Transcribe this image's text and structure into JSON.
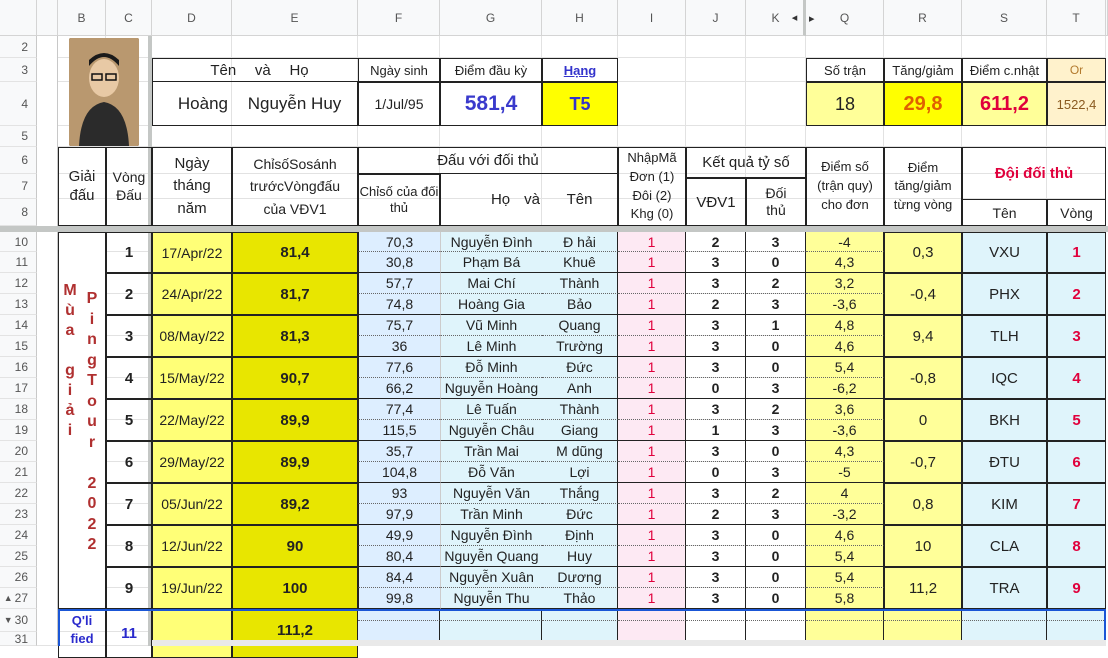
{
  "columns": [
    "B",
    "C",
    "D",
    "E",
    "F",
    "G",
    "H",
    "I",
    "J",
    "K",
    "Q",
    "R",
    "S",
    "T"
  ],
  "rows": [
    "2",
    "3",
    "4",
    "5",
    "6",
    "7",
    "8",
    "10",
    "11",
    "12",
    "13",
    "14",
    "15",
    "16",
    "17",
    "18",
    "19",
    "20",
    "21",
    "22",
    "23",
    "24",
    "25",
    "26",
    "27",
    "30",
    "31"
  ],
  "header": {
    "name_label1": "Tên",
    "name_label2": "và",
    "name_label3": "Họ",
    "birth_label": "Ngày sinh",
    "start_points_label": "Điểm đầu kỳ",
    "rank_label": "Hạng",
    "first_name": "Hoàng",
    "last_name": "Nguyễn Huy",
    "birth_date": "1/Jul/95",
    "start_points": "581,4",
    "rank": "T5",
    "matches_label": "Số trận",
    "change_label": "Tăng/giảm",
    "updated_label": "Điểm c.nhật",
    "or_label": "Or",
    "matches": "18",
    "change": "29,8",
    "updated": "611,2",
    "or_value": "1522,4"
  },
  "table_header": {
    "tournament": "Giải đấu",
    "round": "Vòng Đấu",
    "date": "Ngày tháng năm",
    "index_before": "ChỉsốSosánh trướcVòngđấu của VĐV1",
    "vs_opponent": "Đấu với đối thủ",
    "opp_index": "Chỉsố của đối thủ",
    "opp_name_a": "Họ",
    "opp_name_b": "và",
    "opp_name_c": "Tên",
    "input_code": "NhậpMã Đơn (1) Đôi (2) Khg (0)",
    "result": "Kết quả tỷ số",
    "vdv1": "VĐV1",
    "opponent": "Đối thủ",
    "score": "Điểm số (trận quy) cho đơn",
    "points_change": "Điểm tăng/giảm từng vòng",
    "opp_team": "Đội đối thủ",
    "team_name": "Tên",
    "team_round": "Vòng"
  },
  "tournament_title_col1": [
    "M",
    "ù",
    "a",
    "",
    "g",
    "i",
    "ả",
    "i"
  ],
  "tournament_title_col2": [
    "P",
    "i",
    "n",
    "g",
    "T",
    "o",
    "u",
    "r",
    "",
    "2",
    "0",
    "2",
    "2"
  ],
  "rounds": [
    {
      "round": "1",
      "date": "17/Apr/22",
      "index": "81,4",
      "change": "0,3",
      "team": "VXU",
      "team_round": "1",
      "matches": [
        {
          "opp_index": "70,3",
          "mid": "Nguyễn Đình",
          "last": "Đ hải",
          "code": "1",
          "v1": "2",
          "v2": "3",
          "score": "-4"
        },
        {
          "opp_index": "30,8",
          "mid": "Phạm Bá",
          "last": "Khuê",
          "code": "1",
          "v1": "3",
          "v2": "0",
          "score": "4,3"
        }
      ]
    },
    {
      "round": "2",
      "date": "24/Apr/22",
      "index": "81,7",
      "change": "-0,4",
      "team": "PHX",
      "team_round": "2",
      "matches": [
        {
          "opp_index": "57,7",
          "mid": "Mai Chí",
          "last": "Thành",
          "code": "1",
          "v1": "3",
          "v2": "2",
          "score": "3,2"
        },
        {
          "opp_index": "74,8",
          "mid": "Hoàng Gia",
          "last": "Bảo",
          "code": "1",
          "v1": "2",
          "v2": "3",
          "score": "-3,6"
        }
      ]
    },
    {
      "round": "3",
      "date": "08/May/22",
      "index": "81,3",
      "change": "9,4",
      "team": "TLH",
      "team_round": "3",
      "matches": [
        {
          "opp_index": "75,7",
          "mid": "Vũ Minh",
          "last": "Quang",
          "code": "1",
          "v1": "3",
          "v2": "1",
          "score": "4,8"
        },
        {
          "opp_index": "36",
          "mid": "Lê Minh",
          "last": "Trường",
          "code": "1",
          "v1": "3",
          "v2": "0",
          "score": "4,6"
        }
      ]
    },
    {
      "round": "4",
      "date": "15/May/22",
      "index": "90,7",
      "change": "-0,8",
      "team": "IQC",
      "team_round": "4",
      "matches": [
        {
          "opp_index": "77,6",
          "mid": "Đỗ Minh",
          "last": "Đức",
          "code": "1",
          "v1": "3",
          "v2": "0",
          "score": "5,4"
        },
        {
          "opp_index": "66,2",
          "mid": "Nguyễn Hoàng",
          "last": "Anh",
          "code": "1",
          "v1": "0",
          "v2": "3",
          "score": "-6,2"
        }
      ]
    },
    {
      "round": "5",
      "date": "22/May/22",
      "index": "89,9",
      "change": "0",
      "team": "BKH",
      "team_round": "5",
      "matches": [
        {
          "opp_index": "77,4",
          "mid": "Lê Tuấn",
          "last": "Thành",
          "code": "1",
          "v1": "3",
          "v2": "2",
          "score": "3,6"
        },
        {
          "opp_index": "115,5",
          "mid": "Nguyễn Châu",
          "last": "Giang",
          "code": "1",
          "v1": "1",
          "v2": "3",
          "score": "-3,6"
        }
      ]
    },
    {
      "round": "6",
      "date": "29/May/22",
      "index": "89,9",
      "change": "-0,7",
      "team": "ĐTU",
      "team_round": "6",
      "matches": [
        {
          "opp_index": "35,7",
          "mid": "Trần Mai",
          "last": "M dũng",
          "code": "1",
          "v1": "3",
          "v2": "0",
          "score": "4,3"
        },
        {
          "opp_index": "104,8",
          "mid": "Đỗ Văn",
          "last": "Lợi",
          "code": "1",
          "v1": "0",
          "v2": "3",
          "score": "-5"
        }
      ]
    },
    {
      "round": "7",
      "date": "05/Jun/22",
      "index": "89,2",
      "change": "0,8",
      "team": "KIM",
      "team_round": "7",
      "matches": [
        {
          "opp_index": "93",
          "mid": "Nguyễn Văn",
          "last": "Thắng",
          "code": "1",
          "v1": "3",
          "v2": "2",
          "score": "4"
        },
        {
          "opp_index": "97,9",
          "mid": "Trần Minh",
          "last": "Đức",
          "code": "1",
          "v1": "2",
          "v2": "3",
          "score": "-3,2"
        }
      ]
    },
    {
      "round": "8",
      "date": "12/Jun/22",
      "index": "90",
      "change": "10",
      "team": "CLA",
      "team_round": "8",
      "matches": [
        {
          "opp_index": "49,9",
          "mid": "Nguyễn Đình",
          "last": "Định",
          "code": "1",
          "v1": "3",
          "v2": "0",
          "score": "4,6"
        },
        {
          "opp_index": "80,4",
          "mid": "Nguyễn Quang",
          "last": "Huy",
          "code": "1",
          "v1": "3",
          "v2": "0",
          "score": "5,4"
        }
      ]
    },
    {
      "round": "9",
      "date": "19/Jun/22",
      "index": "100",
      "change": "11,2",
      "team": "TRA",
      "team_round": "9",
      "matches": [
        {
          "opp_index": "84,4",
          "mid": "Nguyễn Xuân",
          "last": "Dương",
          "code": "1",
          "v1": "3",
          "v2": "0",
          "score": "5,4"
        },
        {
          "opp_index": "99,8",
          "mid": "Nguyễn Thu",
          "last": "Thảo",
          "code": "1",
          "v1": "3",
          "v2": "0",
          "score": "5,8"
        }
      ]
    }
  ],
  "bottom_row": {
    "label": "Q'li fied",
    "round": "11",
    "index": "111,2"
  },
  "colors": {
    "yellow": "#ffff77",
    "pale_yellow": "#ffff99",
    "bright_yellow": "#ffff00",
    "dark_yellow": "#e8e600",
    "light_blue": "#ddeeff",
    "light_cyan": "#dff4fb",
    "pink": "#fde9f3",
    "peach": "#fff2cc",
    "red": "#e0003c",
    "maroon": "#b03030",
    "blue_text": "#3333cc",
    "selection": "#1a56d6"
  }
}
